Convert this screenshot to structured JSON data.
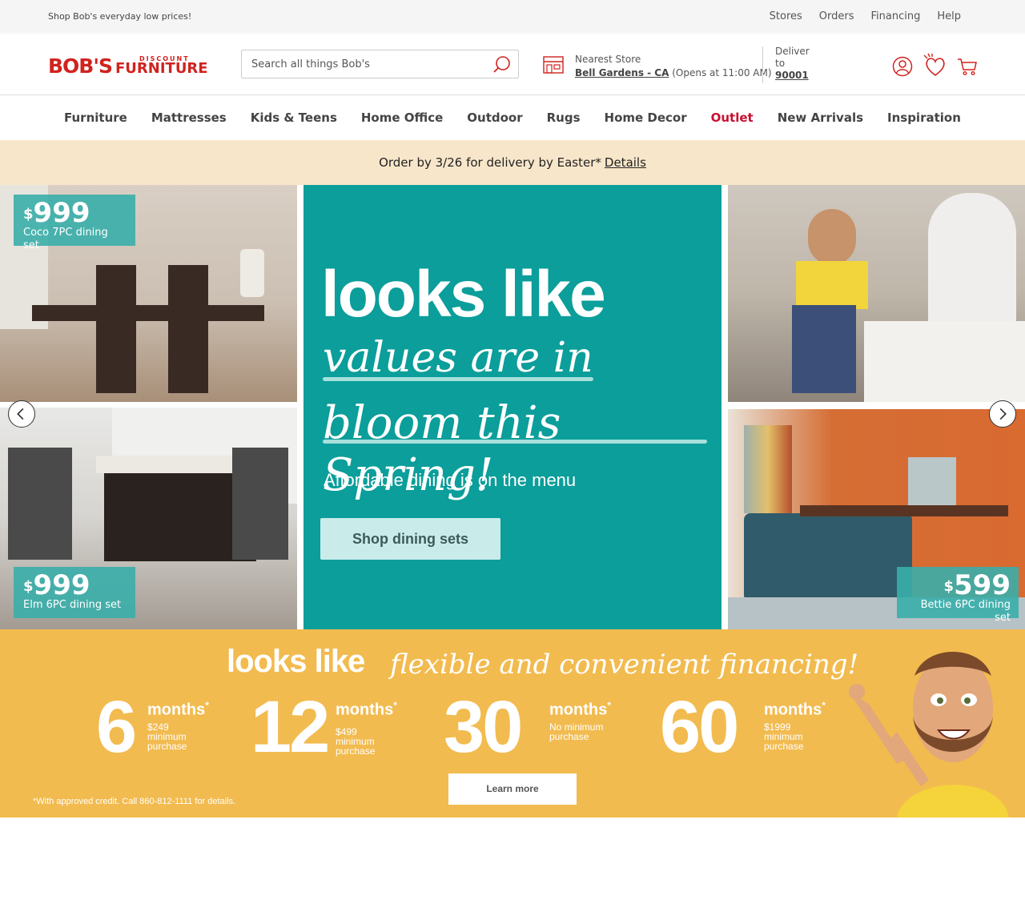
{
  "topbar": {
    "promo": "Shop Bob's everyday low prices!",
    "links": [
      "Stores",
      "Orders",
      "Financing",
      "Help"
    ]
  },
  "header": {
    "logo_main": "BOB'S",
    "logo_small": "DISCOUNT",
    "logo_sub": "FURNITURE",
    "search_placeholder": "Search all things Bob's",
    "store_label": "Nearest Store",
    "store_name": "Bell Gardens - CA",
    "store_hours": "(Opens at 11:00 AM)",
    "deliver_label": "Deliver",
    "deliver_to": "to",
    "zip": "90001"
  },
  "nav": [
    "Furniture",
    "Mattresses",
    "Kids & Teens",
    "Home Office",
    "Outdoor",
    "Rugs",
    "Home Decor",
    "Outlet",
    "New Arrivals",
    "Inspiration"
  ],
  "announce": {
    "text": "Order by 3/26 for delivery by Easter*",
    "link": "Details"
  },
  "hero": {
    "tags": [
      {
        "price": "999",
        "desc": "Coco 7PC dining set"
      },
      {
        "price": "999",
        "desc": "Elm 6PC dining set"
      },
      {
        "price": "599",
        "desc": "Bettie 6PC dining set"
      }
    ],
    "currency": "$",
    "line1": "looks like",
    "line2": "values are in",
    "line3": "bloom this Spring!",
    "subtitle": "Affordable dining is on the menu",
    "cta": "Shop dining sets"
  },
  "financing": {
    "head1": "looks like",
    "head2": "flexible and convenient financing!",
    "months_label": "months",
    "terms": [
      {
        "num": "6",
        "line1": "$249",
        "line2": "minimum",
        "line3": "purchase"
      },
      {
        "num": "12",
        "line1": "$499",
        "line2": "minimum",
        "line3": "purchase"
      },
      {
        "num": "30",
        "line1": "No minimum",
        "line2": "purchase",
        "line3": ""
      },
      {
        "num": "60",
        "line1": "$1999",
        "line2": "minimum",
        "line3": "purchase"
      }
    ],
    "cta": "Learn more",
    "disclaimer": "*With approved credit. Call 860-812-1111 for details."
  },
  "colors": {
    "brand_red": "#d0231f",
    "teal": "#0b9e9a",
    "financing_yellow": "#f2bb4f",
    "announce_bg": "#f8e6ca"
  }
}
